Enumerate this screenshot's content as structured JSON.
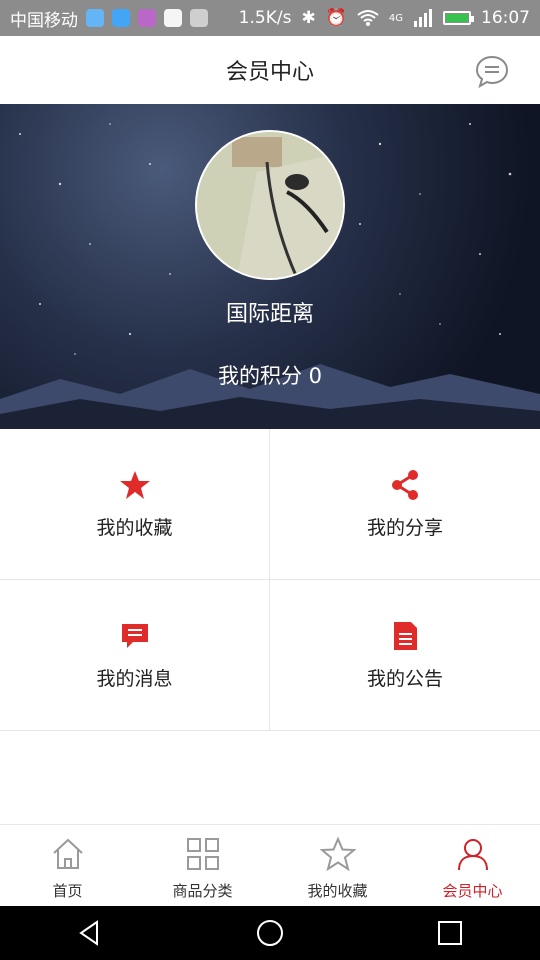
{
  "status_bar": {
    "carrier": "中国移动",
    "net_speed": "1.5K/s",
    "network_type": "4G",
    "time": "16:07"
  },
  "header": {
    "title": "会员中心",
    "message_icon": "chat-icon"
  },
  "profile": {
    "username": "国际距离",
    "points": "我的积分 0"
  },
  "menu": [
    {
      "label": "我的收藏",
      "icon": "star-icon"
    },
    {
      "label": "我的分享",
      "icon": "share-icon"
    },
    {
      "label": "我的消息",
      "icon": "message-icon"
    },
    {
      "label": "我的公告",
      "icon": "document-icon"
    }
  ],
  "tabs": [
    {
      "label": "首页",
      "icon": "home-icon"
    },
    {
      "label": "商品分类",
      "icon": "grid-icon"
    },
    {
      "label": "我的收藏",
      "icon": "star-outline-icon"
    },
    {
      "label": "会员中心",
      "icon": "person-icon",
      "active": true
    }
  ],
  "colors": {
    "accent": "#e02b2b",
    "active_tab": "#d02028",
    "status_bar": "#8c8c8c"
  }
}
